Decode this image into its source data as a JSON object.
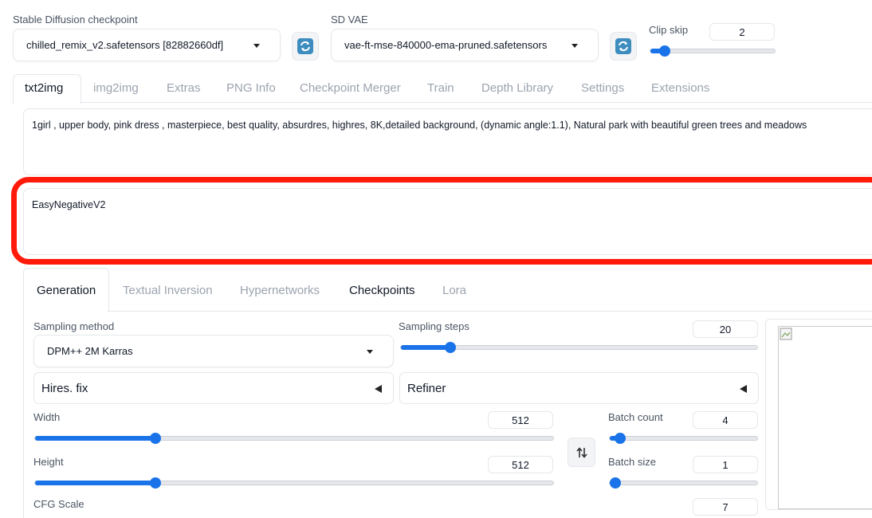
{
  "checkpoint": {
    "label": "Stable Diffusion checkpoint",
    "value": "chilled_remix_v2.safetensors [82882660df]",
    "refresh_icon": "refresh-icon"
  },
  "vae": {
    "label": "SD VAE",
    "value": "vae-ft-mse-840000-ema-pruned.safetensors",
    "refresh_icon": "refresh-icon"
  },
  "clip_skip": {
    "label": "Clip skip",
    "value": "2",
    "min": 1,
    "max": 12
  },
  "tabs": [
    "txt2img",
    "img2img",
    "Extras",
    "PNG Info",
    "Checkpoint Merger",
    "Train",
    "Depth Library",
    "Settings",
    "Extensions"
  ],
  "active_tab": "txt2img",
  "prompt": {
    "positive": "1girl , upper body, pink dress , masterpiece, best quality, absurdres, highres, 8K,detailed background, (dynamic angle:1.1), Natural park with beautiful green trees and meadows",
    "negative": "EasyNegativeV2"
  },
  "highlight_color": "#ff1a0a",
  "subtabs": [
    "Generation",
    "Textual Inversion",
    "Hypernetworks",
    "Checkpoints",
    "Lora"
  ],
  "active_subtab": "Generation",
  "sampling": {
    "method_label": "Sampling method",
    "method_value": "DPM++ 2M Karras",
    "steps_label": "Sampling steps",
    "steps_value": "20",
    "steps_min": 1,
    "steps_max": 150
  },
  "accordions": {
    "hires_label": "Hires. fix",
    "refiner_label": "Refiner"
  },
  "width": {
    "label": "Width",
    "value": "512",
    "min": 64,
    "max": 2048
  },
  "height": {
    "label": "Height",
    "value": "512",
    "min": 64,
    "max": 2048
  },
  "batch_count": {
    "label": "Batch count",
    "value": "4",
    "min": 1,
    "max": 100
  },
  "batch_size": {
    "label": "Batch size",
    "value": "1",
    "min": 1,
    "max": 8
  },
  "swap_icon": "swap-dimensions-icon",
  "cfg": {
    "label": "CFG Scale",
    "value": "7"
  },
  "accent": "#1a73e8"
}
